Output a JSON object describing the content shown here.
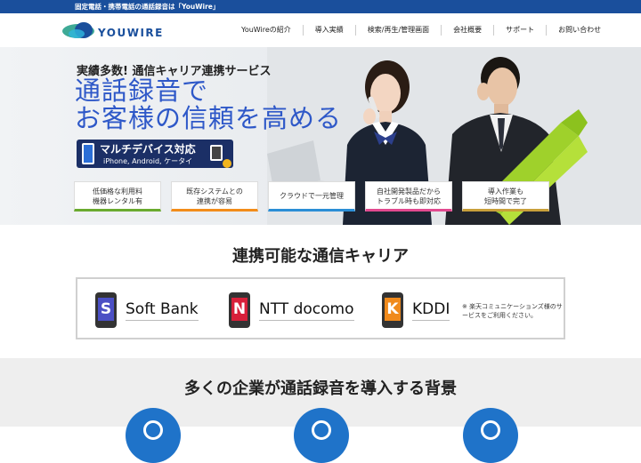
{
  "topbar": {
    "text": "固定電話・携帯電話の通話録音は「YouWire」"
  },
  "header": {
    "logo_text": "YOUWIRE",
    "nav": [
      "YouWireの紹介",
      "導入実績",
      "検索/再生/管理画面",
      "会社概要",
      "サポート",
      "お問い合わせ"
    ]
  },
  "hero": {
    "subtitle": "実績多数! 通信キャリア連携サービス",
    "title_line1": "通話録音で",
    "title_line2": "お客様の信頼を高める",
    "badge_title": "マルチデバイス対応",
    "badge_sub": "iPhone, Android, ケータイ",
    "features": [
      {
        "line1": "低価格な利用料",
        "line2": "機器レンタル有"
      },
      {
        "line1": "既存システムとの",
        "line2": "連携が容易"
      },
      {
        "line1": "クラウドで一元管理",
        "line2": ""
      },
      {
        "line1": "自社開発製品だから",
        "line2": "トラブル時も即対応"
      },
      {
        "line1": "導入作業も",
        "line2": "短時間で完了"
      }
    ]
  },
  "carriers": {
    "title": "連携可能な通信キャリア",
    "items": [
      {
        "letter": "S",
        "name": "Soft Bank",
        "color": "#4b4fc4"
      },
      {
        "letter": "N",
        "name": "NTT docomo",
        "color": "#d8203a"
      },
      {
        "letter": "K",
        "name": "KDDI",
        "color": "#f08a1c"
      }
    ],
    "note": "※ 楽天コミュニケーションズ様のサービスをご利用ください。"
  },
  "background": {
    "title": "多くの企業が通話録音を導入する背景"
  },
  "colors": {
    "brand_blue": "#1a4f9c",
    "hero_blue": "#2e58c8",
    "icon_blue": "#1f73c9"
  }
}
